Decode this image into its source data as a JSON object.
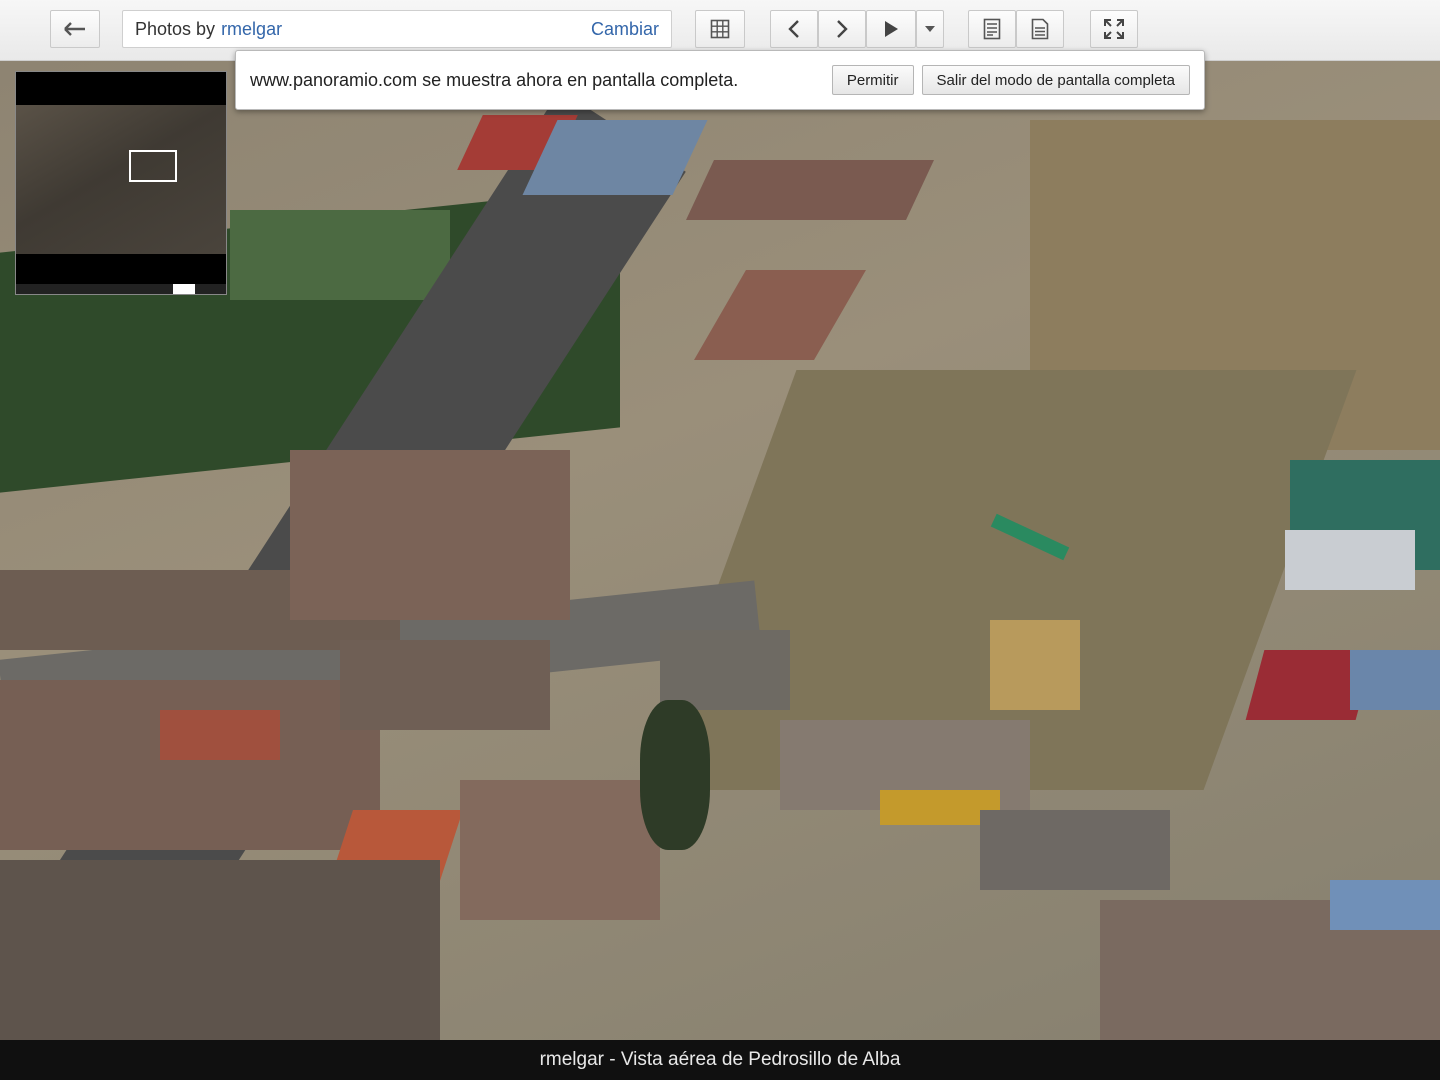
{
  "toolbar": {
    "breadcrumb_prefix": "Photos by",
    "breadcrumb_user": "rmelgar",
    "change_label": "Cambiar"
  },
  "icons": {
    "back": "back-arrow-icon",
    "grid": "grid-icon",
    "previous": "chevron-left-icon",
    "next": "chevron-right-icon",
    "play": "play-icon",
    "dropdown": "chevron-down-icon",
    "info": "info-panel-icon",
    "page": "page-icon",
    "fullscreen": "fullscreen-icon"
  },
  "notice": {
    "message": "www.panoramio.com se muestra ahora en pantalla completa.",
    "allow_label": "Permitir",
    "exit_label": "Salir del modo de pantalla completa"
  },
  "caption": {
    "text": "rmelgar - Vista aérea de Pedrosillo de Alba"
  },
  "colors": {
    "toolbar_bg": "#efefef",
    "link": "#3366aa",
    "caption_bg": "#101010"
  }
}
